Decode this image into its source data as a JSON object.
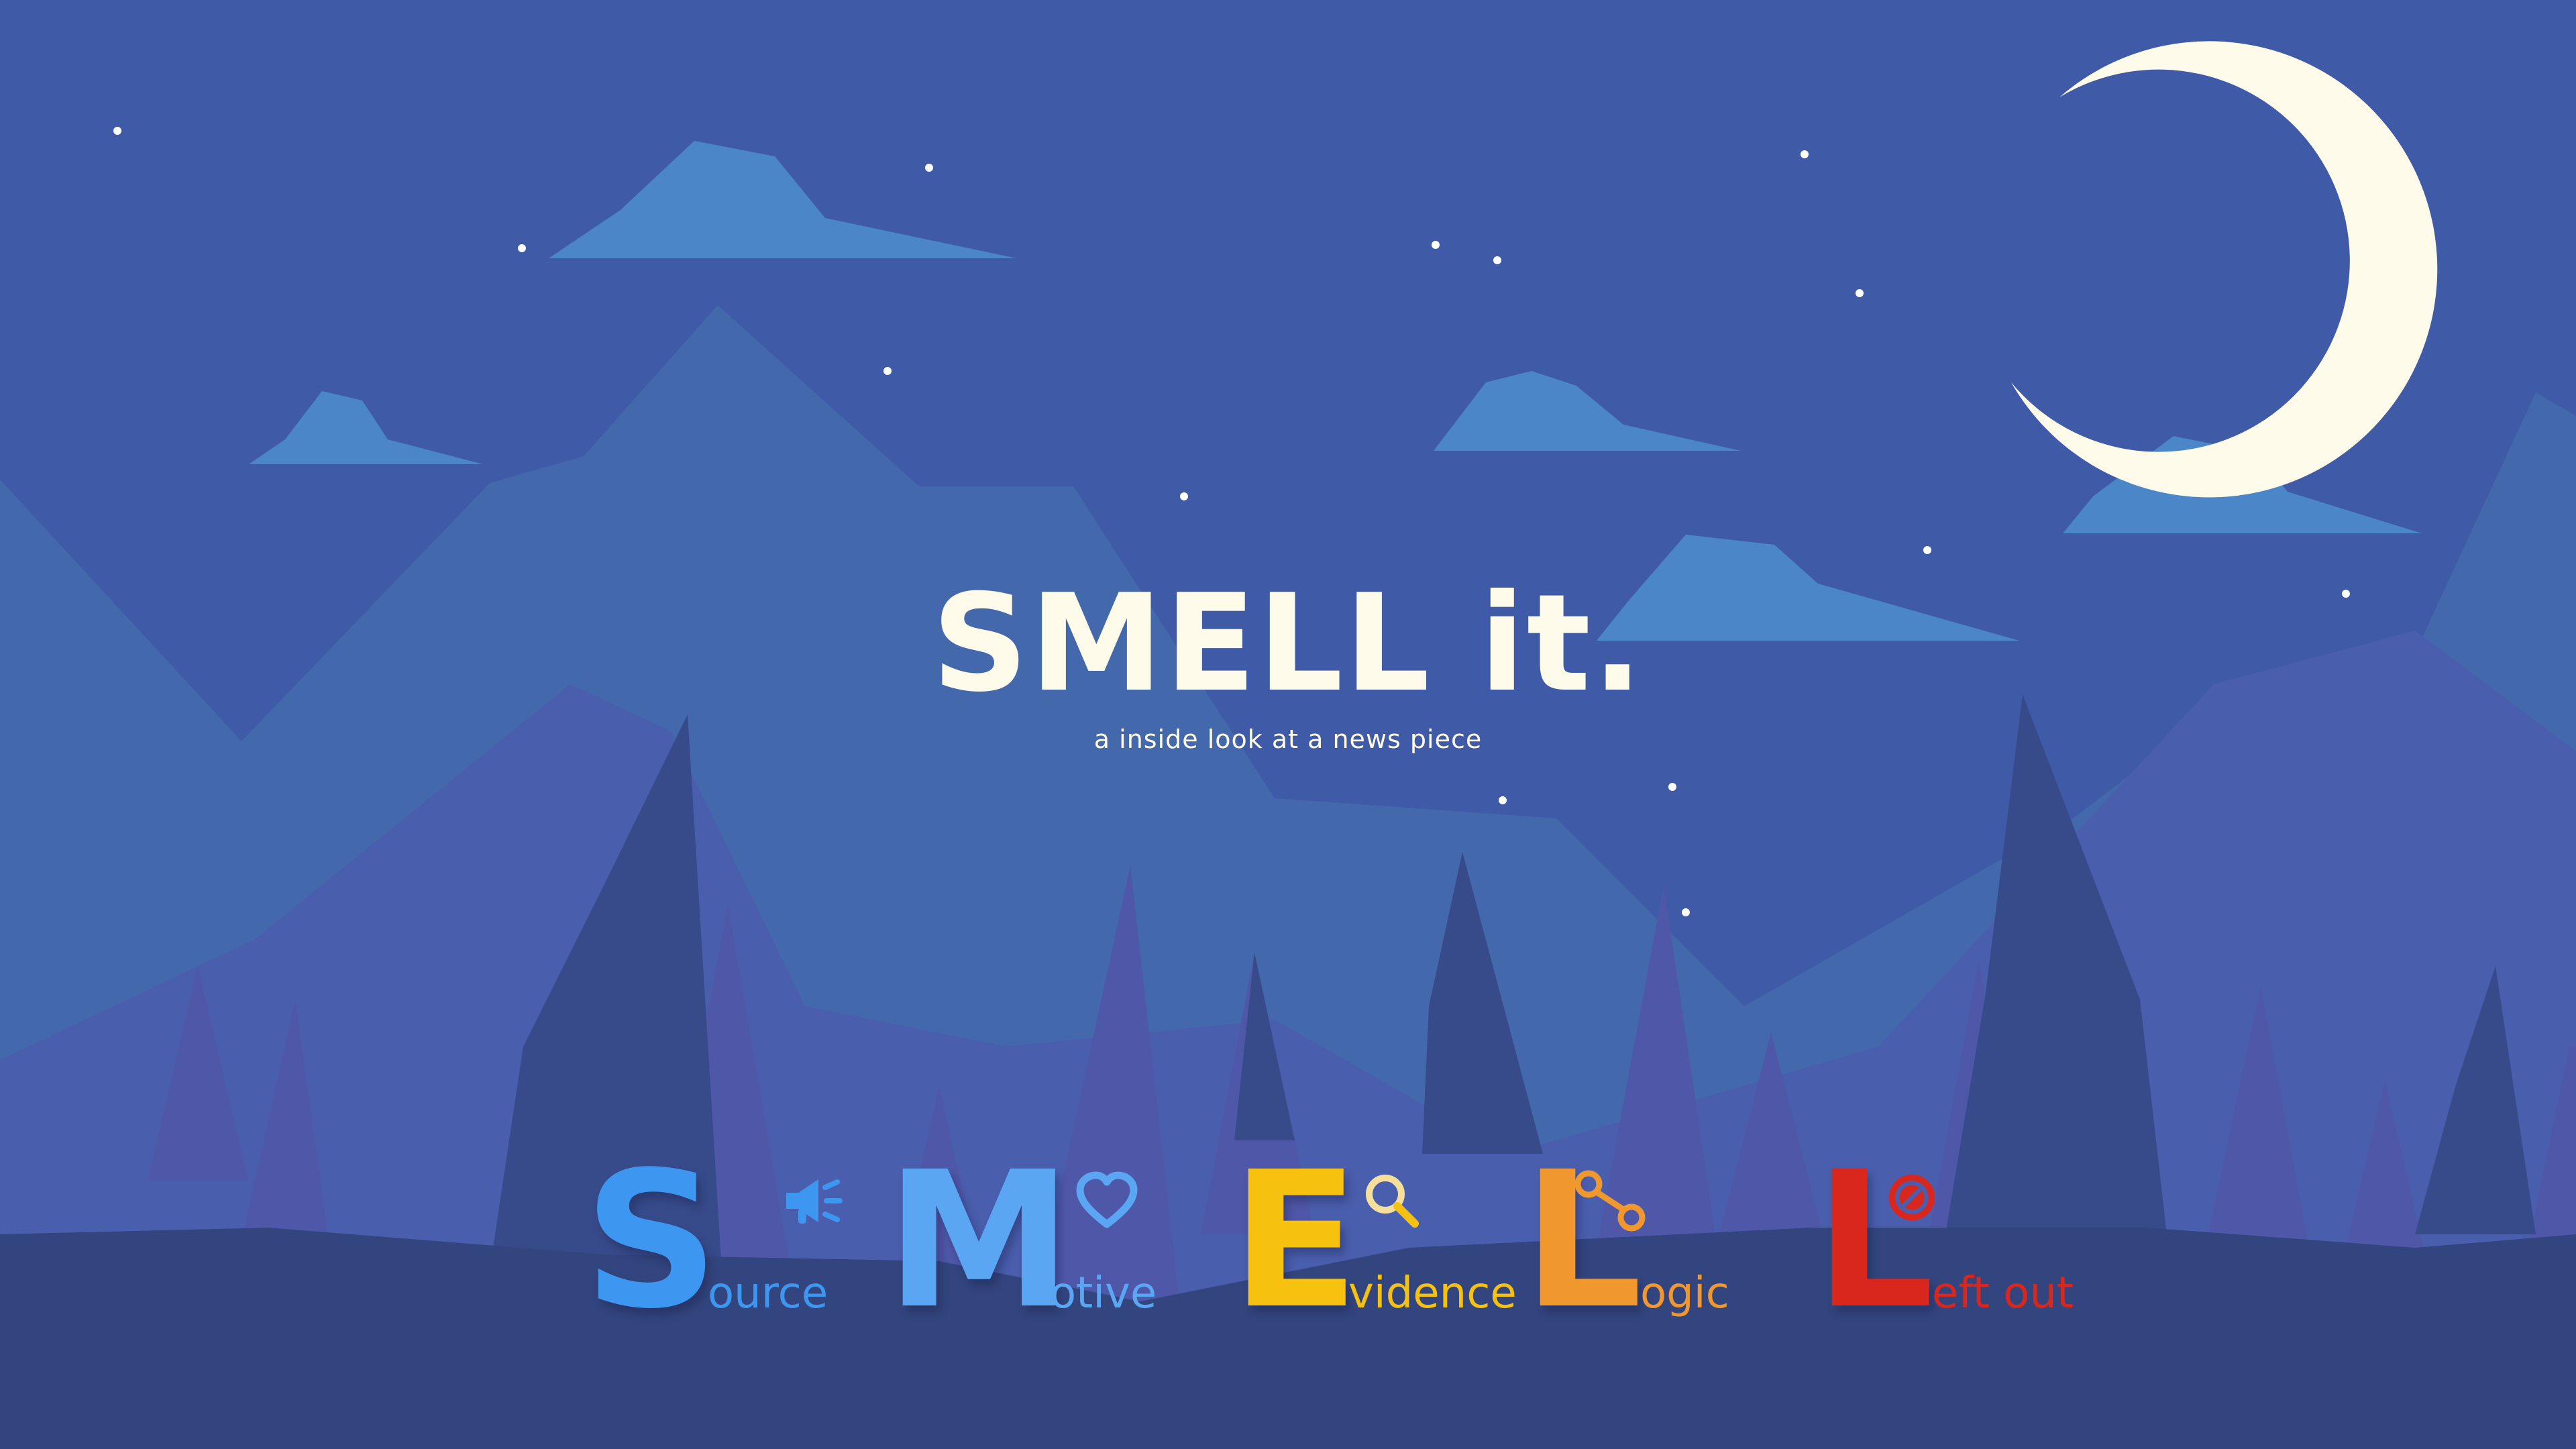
{
  "title": "SMELL it.",
  "subtitle": "a inside look at a news piece",
  "acronym": [
    {
      "letter": "S",
      "rest": "ource",
      "color": "#3d97f0",
      "icon": "megaphone-icon"
    },
    {
      "letter": "M",
      "rest": "otive",
      "color": "#5aa6f2",
      "icon": "heart-icon"
    },
    {
      "letter": "E",
      "rest": "vidence",
      "color": "#f7c20f",
      "icon": "magnifier-icon"
    },
    {
      "letter": "L",
      "rest": "ogic",
      "color": "#f0972e",
      "icon": "link-icon"
    },
    {
      "letter": "L",
      "rest": "eft out",
      "color": "#d9271e",
      "icon": "no-entry-icon"
    }
  ],
  "colors": {
    "sky": "#3f5ba8",
    "moon": "#fffbea",
    "cloud": "#4a86c8",
    "mountain_far": "#4368ac",
    "mountain_mid": "#4a5eae",
    "trees_back": "#4d5aa8",
    "trees_front": "#374a8a",
    "ground": "#33457e"
  }
}
